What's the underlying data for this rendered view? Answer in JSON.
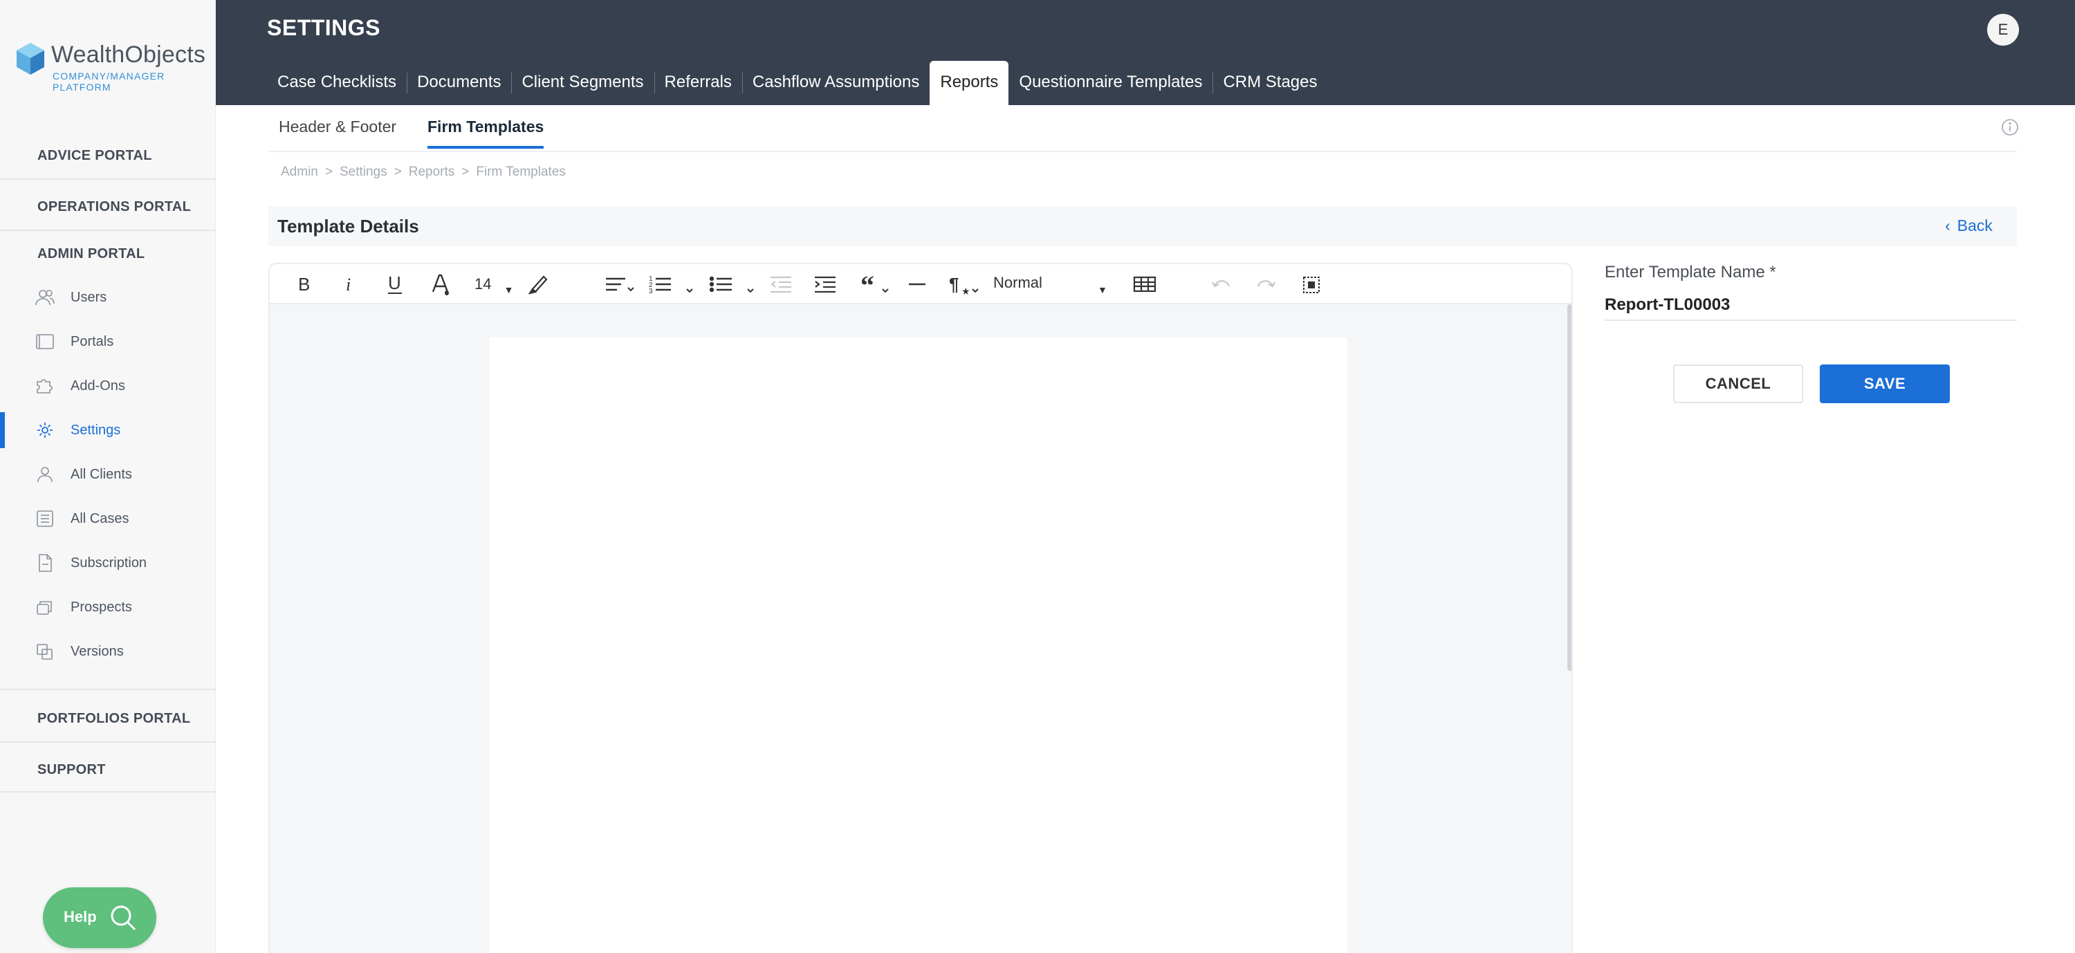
{
  "brand": {
    "name": "WealthObjects",
    "subtitle": "COMPANY/MANAGER PLATFORM",
    "accent": "#2f8fd6"
  },
  "sidebar": {
    "portals": {
      "advice": "ADVICE PORTAL",
      "operations": "OPERATIONS PORTAL",
      "admin": "ADMIN PORTAL",
      "portfolios": "PORTFOLIOS PORTAL",
      "support": "SUPPORT"
    },
    "items": [
      {
        "label": "Users",
        "icon": "users-icon"
      },
      {
        "label": "Portals",
        "icon": "portals-icon"
      },
      {
        "label": "Add-Ons",
        "icon": "puzzle-icon"
      },
      {
        "label": "Settings",
        "icon": "gear-icon",
        "active": true
      },
      {
        "label": "All Clients",
        "icon": "person-icon"
      },
      {
        "label": "All Cases",
        "icon": "list-icon"
      },
      {
        "label": "Subscription",
        "icon": "document-icon"
      },
      {
        "label": "Prospects",
        "icon": "stack-icon"
      },
      {
        "label": "Versions",
        "icon": "versions-icon"
      }
    ],
    "active_color": "#1b6fd6"
  },
  "help": {
    "label": "Help",
    "icon": "search-icon",
    "color": "#5fbf7d"
  },
  "header": {
    "title": "SETTINGS",
    "avatar_initial": "E",
    "background": "#36404e",
    "tabs": [
      {
        "label": "Case Checklists"
      },
      {
        "label": "Documents"
      },
      {
        "label": "Client Segments"
      },
      {
        "label": "Referrals"
      },
      {
        "label": "Cashflow Assumptions"
      },
      {
        "label": "Reports",
        "active": true
      },
      {
        "label": "Questionnaire Templates"
      },
      {
        "label": "CRM Stages"
      }
    ]
  },
  "subtabs": [
    {
      "label": "Header & Footer"
    },
    {
      "label": "Firm Templates",
      "active": true
    }
  ],
  "breadcrumb": [
    "Admin",
    "Settings",
    "Reports",
    "Firm Templates"
  ],
  "details": {
    "title": "Template Details",
    "back_label": "Back"
  },
  "editor": {
    "font_size": "14",
    "paragraph_style": "Normal",
    "toolbar_icons": [
      "bold-icon",
      "italic-icon",
      "underline-icon",
      "font-color-icon",
      "font-size-select",
      "highlight-icon",
      "align-icon",
      "ordered-list-icon",
      "bullet-list-icon",
      "outdent-icon",
      "indent-icon",
      "quote-icon",
      "horizontal-rule-icon",
      "paragraph-format-icon",
      "paragraph-style-select",
      "table-icon",
      "undo-icon",
      "redo-icon",
      "select-all-icon"
    ]
  },
  "form": {
    "name_label": "Enter Template Name *",
    "name_value": "Report-TL00003",
    "cancel_label": "CANCEL",
    "save_label": "SAVE",
    "primary_color": "#1b6fd6"
  }
}
